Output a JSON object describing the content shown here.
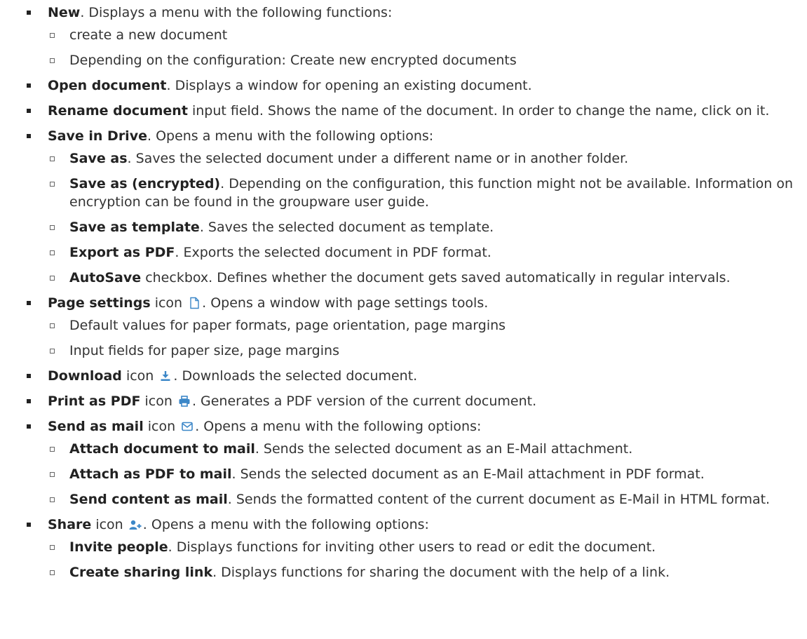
{
  "items": [
    {
      "title": "New",
      "desc": ". Displays a menu with the following functions:",
      "sub": [
        {
          "text": "create a new document"
        },
        {
          "text": "Depending on the configuration: Create new encrypted documents"
        }
      ]
    },
    {
      "title": "Open document",
      "desc": ". Displays a window for opening an existing document."
    },
    {
      "title": "Rename document",
      "desc": " input field. Shows the name of the document. In order to change the name, click on it."
    },
    {
      "title": "Save in Drive",
      "desc": ". Opens a menu with the following options:",
      "sub": [
        {
          "title": "Save as",
          "desc": ". Saves the selected document under a different name or in another folder."
        },
        {
          "title": "Save as (encrypted)",
          "desc": ". Depending on the configuration, this function might not be available. Infor­mation on encryption can be found in the groupware user guide."
        },
        {
          "title": "Save as template",
          "desc": ". Saves the selected document as template."
        },
        {
          "title": "Export as PDF",
          "desc": ". Exports the selected document in PDF format."
        },
        {
          "title": "AutoSave",
          "desc": " checkbox. Defines whether the document gets saved automatically in regular intervals."
        }
      ]
    },
    {
      "title": "Page settings",
      "icon_label": " icon ",
      "desc": ". Opens a window with page settings tools.",
      "sub": [
        {
          "text": "Default values for paper formats, page orientation, page margins"
        },
        {
          "text": "Input fields for paper size, page margins"
        }
      ]
    },
    {
      "title": "Download",
      "icon_label": " icon ",
      "desc": ". Downloads the selected document."
    },
    {
      "title": "Print as PDF",
      "icon_label": " icon ",
      "desc": ". Generates a PDF version of the current document."
    },
    {
      "title": "Send as mail",
      "icon_label": " icon ",
      "desc": ". Opens a menu with the following options:",
      "sub": [
        {
          "title": "Attach document to mail",
          "desc": ". Sends the selected document as an E-Mail attachment."
        },
        {
          "title": "Attach as PDF to mail",
          "desc": ". Sends the selected document as an E-Mail attachment in PDF format."
        },
        {
          "title": "Send content as mail",
          "desc": ". Sends the formatted content of the current document as E-Mail in HTML format."
        }
      ]
    },
    {
      "title": "Share",
      "icon_label": " icon ",
      "desc": ". Opens a menu with the following options:",
      "sub": [
        {
          "title": "Invite people",
          "desc": ". Displays functions for inviting other users to read or edit the document."
        },
        {
          "title": "Create sharing link",
          "desc": ". Displays functions for sharing the document with the help of a link."
        }
      ]
    }
  ],
  "icons": {
    "page_settings": "file-icon",
    "download": "download-icon",
    "print": "print-icon",
    "mail": "envelope-icon",
    "share": "add-user-icon",
    "icon_color": "#3c87c8"
  }
}
